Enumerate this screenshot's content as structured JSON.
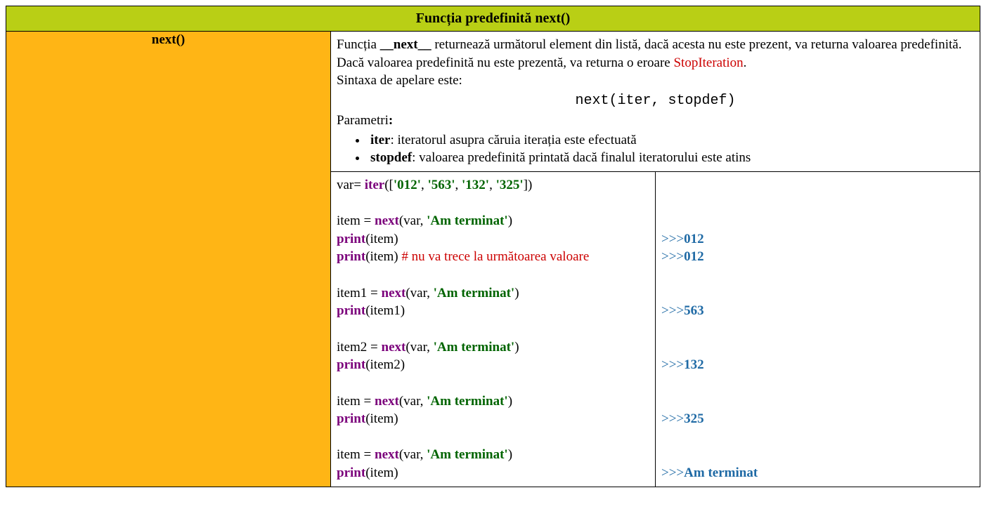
{
  "header": {
    "title": "Funcția predefinită next()"
  },
  "sidebar": {
    "label": "next()"
  },
  "desc": {
    "line1_pre": "Funcția ",
    "line1_bold": "__next__",
    "line1_post": " returnează următorul element din listă, dacă acesta nu este prezent, va returna valoarea predefinită.",
    "line2_pre": "Dacă valoarea predefinită nu este prezentă, va returna o eroare ",
    "line2_err": "StopIteration",
    "line2_post": ".",
    "line3": "Sintaxa de apelare este:",
    "syntax": "next(iter, stopdef)",
    "params_label": "Parametri",
    "params_colon": ":",
    "param1_name": "iter",
    "param1_desc": ": iteratorul asupra căruia iterația este efectuată",
    "param2_name": "stopdef",
    "param2_desc": ": valoarea predefinită printată dacă finalul iteratorului este atins"
  },
  "code": {
    "l1": {
      "a": "var= ",
      "kw": "iter",
      "b": "([",
      "s1": "'012'",
      "c1": ", ",
      "s2": "'563'",
      "c2": ", ",
      "s3": "'132'",
      "c3": ", ",
      "s4": "'325'",
      "d": "])"
    },
    "l3": {
      "a": "item = ",
      "kw": "next",
      "b": "(var, ",
      "s": "'Am terminat'",
      "c": ")"
    },
    "l4": {
      "kw": "print",
      "a": "(item)"
    },
    "l5": {
      "kw": "print",
      "a": "(item)    ",
      "cmt": "# nu va trece la următoarea valoare"
    },
    "l7": {
      "a": "item1 = ",
      "kw": "next",
      "b": "(var, ",
      "s": "'Am terminat'",
      "c": ")"
    },
    "l8": {
      "kw": "print",
      "a": "(item1)"
    },
    "l10": {
      "a": "item2 = ",
      "kw": "next",
      "b": "(var, ",
      "s": "'Am terminat'",
      "c": ")"
    },
    "l11": {
      "kw": "print",
      "a": "(item2)"
    },
    "l13": {
      "a": "item = ",
      "kw": "next",
      "b": "(var, ",
      "s": "'Am terminat'",
      "c": ")"
    },
    "l14": {
      "kw": "print",
      "a": "(item)"
    },
    "l16": {
      "a": "item = ",
      "kw": "next",
      "b": "(var, ",
      "s": "'Am terminat'",
      "c": ")"
    },
    "l17": {
      "kw": "print",
      "a": "(item)"
    }
  },
  "out": {
    "prompt": ">>>",
    "o1": "012",
    "o2": "012",
    "o3": "563",
    "o4": "132",
    "o5": "325",
    "o6": "Am terminat"
  }
}
